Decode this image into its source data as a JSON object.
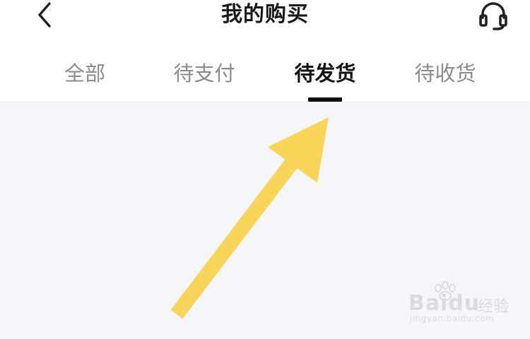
{
  "header": {
    "title": "我的购买",
    "back_icon": "chevron-left-icon",
    "support_icon": "headset-icon"
  },
  "tabs": [
    {
      "label": "全部",
      "active": false
    },
    {
      "label": "待支付",
      "active": false
    },
    {
      "label": "待发货",
      "active": true
    },
    {
      "label": "待收货",
      "active": false
    }
  ],
  "annotation": {
    "arrow_color": "#F8D458"
  },
  "watermark": {
    "brand": "Baidu",
    "brand_cn": "经验",
    "url": "jingyan.baidu.com"
  },
  "colors": {
    "active_tab": "#111111",
    "inactive_tab": "#8A8A8F",
    "content_bg": "#F5F6F9"
  }
}
